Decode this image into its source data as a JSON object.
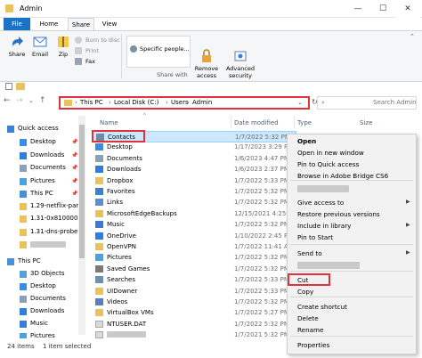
{
  "window": {
    "title": "Admin",
    "controls": {
      "minimize": "—",
      "maximize": "☐",
      "close": "✕"
    }
  },
  "ribbon": {
    "tabs": [
      "File",
      "Home",
      "Share",
      "View"
    ],
    "share": {
      "share_label": "Share",
      "email_label": "Email",
      "zip_label": "Zip",
      "burn_label": "Burn to disc",
      "print_label": "Print",
      "fax_label": "Fax",
      "specific_people": "Specific people...",
      "share_with_label": "Share with",
      "remove_access": "Remove\naccess",
      "advanced_security": "Advanced\nsecurity"
    }
  },
  "address": {
    "path": [
      "This PC",
      "Local Disk (C:)",
      "Users",
      "Admin"
    ],
    "search_placeholder": "Search Admin"
  },
  "nav": {
    "items": [
      {
        "label": "Quick access",
        "pinned": false,
        "icon": "star-icon",
        "indent": 0
      },
      {
        "label": "Desktop",
        "pinned": true,
        "icon": "folder-blue-icon",
        "indent": 1
      },
      {
        "label": "Downloads",
        "pinned": true,
        "icon": "download-icon",
        "indent": 1
      },
      {
        "label": "Documents",
        "pinned": true,
        "icon": "document-icon",
        "indent": 1
      },
      {
        "label": "Pictures",
        "pinned": true,
        "icon": "picture-icon",
        "indent": 1
      },
      {
        "label": "This PC",
        "pinned": true,
        "icon": "pc-icon",
        "indent": 1
      },
      {
        "label": "1.29-netflix-part",
        "pinned": false,
        "icon": "folder-icon",
        "indent": 1
      },
      {
        "label": "1.31-0x8100002f",
        "pinned": false,
        "icon": "folder-icon",
        "indent": 1
      },
      {
        "label": "1.31-dns-probe-",
        "pinned": false,
        "icon": "folder-icon",
        "indent": 1
      },
      {
        "label": "",
        "pinned": false,
        "icon": "folder-icon",
        "indent": 1
      },
      {
        "label": "This PC",
        "pinned": false,
        "icon": "pc-icon",
        "indent": 0
      },
      {
        "label": "3D Objects",
        "pinned": false,
        "icon": "cube-icon",
        "indent": 1
      },
      {
        "label": "Desktop",
        "pinned": false,
        "icon": "folder-blue-icon",
        "indent": 1
      },
      {
        "label": "Documents",
        "pinned": false,
        "icon": "document-icon",
        "indent": 1
      },
      {
        "label": "Downloads",
        "pinned": false,
        "icon": "download-icon",
        "indent": 1
      },
      {
        "label": "Music",
        "pinned": false,
        "icon": "music-icon",
        "indent": 1
      },
      {
        "label": "Pictures",
        "pinned": false,
        "icon": "picture-icon",
        "indent": 1
      }
    ]
  },
  "files": {
    "columns": {
      "name": "Name",
      "date": "Date modified",
      "type": "Type",
      "size": "Size"
    },
    "rows": [
      {
        "name": "Contacts",
        "date": "1/7/2022 5:32 PM",
        "icon": "contacts-icon",
        "selected": true
      },
      {
        "name": "Desktop",
        "date": "1/17/2023 3:29 PM",
        "icon": "folder-blue-icon"
      },
      {
        "name": "Documents",
        "date": "1/6/2023 4:47 PM",
        "icon": "document-icon"
      },
      {
        "name": "Downloads",
        "date": "1/6/2023 2:37 PM",
        "icon": "download-icon"
      },
      {
        "name": "Dropbox",
        "date": "1/7/2022 5:33 PM",
        "icon": "folder-icon"
      },
      {
        "name": "Favorites",
        "date": "1/7/2022 5:32 PM",
        "icon": "star-icon"
      },
      {
        "name": "Links",
        "date": "1/7/2022 5:32 PM",
        "icon": "link-icon"
      },
      {
        "name": "MicrosoftEdgeBackups",
        "date": "12/15/2021 4:25 PM",
        "icon": "folder-icon"
      },
      {
        "name": "Music",
        "date": "1/7/2022 5:32 PM",
        "icon": "music-icon"
      },
      {
        "name": "OneDrive",
        "date": "1/10/2022 2:45 PM",
        "icon": "cloud-icon"
      },
      {
        "name": "OpenVPN",
        "date": "1/7/2022 11:41 AM",
        "icon": "folder-icon"
      },
      {
        "name": "Pictures",
        "date": "1/7/2022 5:32 PM",
        "icon": "picture-icon"
      },
      {
        "name": "Saved Games",
        "date": "1/7/2022 5:32 PM",
        "icon": "game-icon"
      },
      {
        "name": "Searches",
        "date": "1/7/2022 5:33 PM",
        "icon": "search-icon"
      },
      {
        "name": "UIDowner",
        "date": "1/7/2022 5:33 PM",
        "icon": "folder-icon"
      },
      {
        "name": "Videos",
        "date": "1/7/2022 5:32 PM",
        "icon": "video-icon"
      },
      {
        "name": "VirtualBox VMs",
        "date": "1/7/2022 5:27 PM",
        "icon": "folder-icon"
      },
      {
        "name": "NTUSER.DAT",
        "date": "1/7/2022 5:32 PM",
        "icon": "file-icon"
      },
      {
        "name": "",
        "date": "1/7/2021 5:32 PM",
        "icon": "file-icon"
      }
    ]
  },
  "status": {
    "count": "24 items",
    "selected": "1 item selected"
  },
  "context_menu": {
    "items": [
      {
        "label": "Open",
        "bold": true
      },
      {
        "label": "Open in new window"
      },
      {
        "label": "Pin to Quick access"
      },
      {
        "label": "Browse in Adobe Bridge CS6"
      },
      {
        "label": ""
      },
      {
        "label": "Give access to",
        "submenu": true
      },
      {
        "label": "Restore previous versions"
      },
      {
        "label": "Include in library",
        "submenu": true
      },
      {
        "label": "Pin to Start"
      },
      {
        "label": "Send to",
        "submenu": true
      },
      {
        "label": "Cut"
      },
      {
        "label": "Copy"
      },
      {
        "label": "Create shortcut"
      },
      {
        "label": "Delete"
      },
      {
        "label": "Rename"
      },
      {
        "label": "Properties"
      }
    ]
  }
}
